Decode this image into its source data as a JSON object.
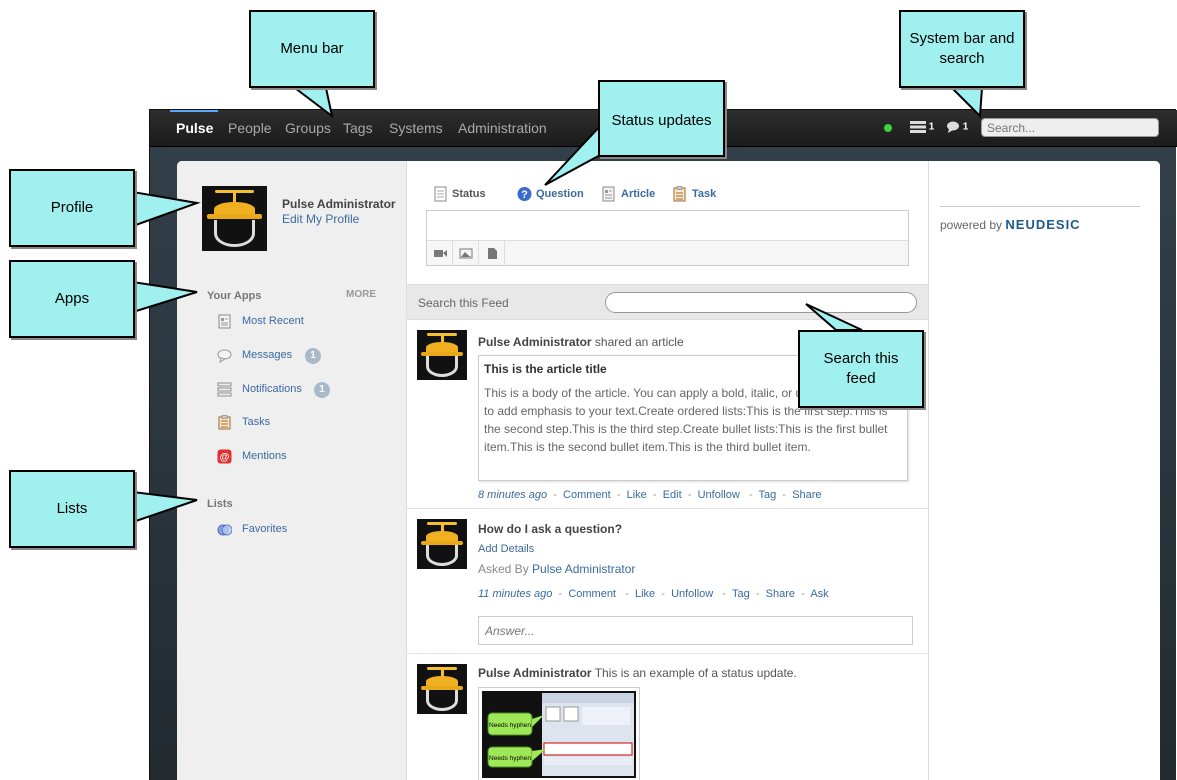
{
  "callouts": {
    "menu_bar": "Menu bar",
    "status_updates": "Status updates",
    "system_bar": "System bar and search",
    "profile": "Profile",
    "apps": "Apps",
    "lists": "Lists",
    "search_feed": "Search this feed"
  },
  "menu": {
    "items": [
      "Pulse",
      "People",
      "Groups",
      "Tags",
      "Systems",
      "Administration"
    ],
    "active": "Pulse"
  },
  "system_bar": {
    "notifications_count": "1",
    "messages_count": "1",
    "search_placeholder": "Search...",
    "status_color": "#3cd03c"
  },
  "profile": {
    "name": "Pulse Administrator",
    "edit_link": "Edit My Profile"
  },
  "apps": {
    "title": "Your Apps",
    "more": "MORE",
    "items": [
      {
        "label": "Most Recent",
        "icon": "document-icon"
      },
      {
        "label": "Messages",
        "icon": "speech-bubble-icon",
        "badge": "1"
      },
      {
        "label": "Notifications",
        "icon": "notification-list-icon",
        "badge": "1"
      },
      {
        "label": "Tasks",
        "icon": "clipboard-icon"
      },
      {
        "label": "Mentions",
        "icon": "at-sign-icon"
      }
    ]
  },
  "lists": {
    "title": "Lists",
    "items": [
      {
        "label": "Favorites",
        "icon": "favorites-icon"
      }
    ]
  },
  "status_tabs": [
    {
      "label": "Status",
      "icon": "status-doc-icon"
    },
    {
      "label": "Question",
      "icon": "question-icon"
    },
    {
      "label": "Article",
      "icon": "article-icon"
    },
    {
      "label": "Task",
      "icon": "task-icon"
    }
  ],
  "feed_search": {
    "label": "Search this Feed",
    "value": ""
  },
  "posts": [
    {
      "author": "Pulse Administrator",
      "action": "shared an article",
      "article_title": "This is the article title",
      "article_body": "This is a body of the article. You can apply a bold, italic, or underline formatting to add emphasis to your text.Create ordered lists:This is the first step.This is the second step.This is the third step.Create bullet lists:This is the first bullet item.This is the second bullet item.This is the third bullet item.",
      "time": "8 minutes ago",
      "actions": [
        "Comment",
        "Like",
        "Edit",
        "Unfollow",
        "Tag",
        "Share"
      ]
    },
    {
      "question": "How do I ask a question?",
      "add_details": "Add Details",
      "asked_by_label": "Asked By",
      "asked_by": "Pulse Administrator",
      "time": "11 minutes ago",
      "actions": [
        "Comment",
        "Like",
        "Unfollow",
        "Tag",
        "Share",
        "Ask"
      ],
      "answer_placeholder": "Answer..."
    },
    {
      "author": "Pulse Administrator",
      "text": "This is an example of a status update.",
      "thumb_label_1": "Needs hyphen",
      "thumb_label_2": "Needs hyphen"
    }
  ],
  "powered": {
    "label": "powered by",
    "brand": "NEUDESIC"
  },
  "colors": {
    "callout_fill": "#9ff0ef",
    "link": "#3a6aa0",
    "topbar": "#222222"
  }
}
